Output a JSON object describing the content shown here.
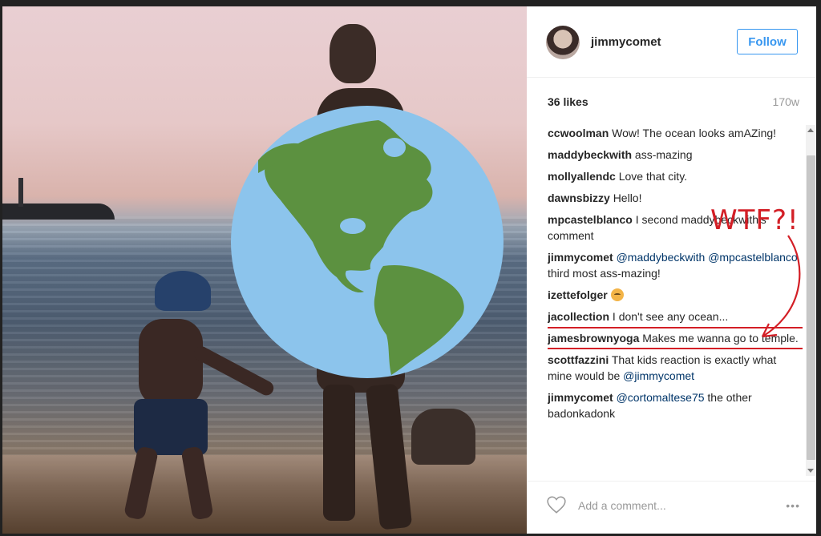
{
  "post": {
    "username": "jimmycomet",
    "follow_label": "Follow",
    "likes": "36 likes",
    "age": "170w",
    "comments": [
      {
        "user": "ccwoolman",
        "parts": [
          {
            "text": "Wow! The ocean looks amAZing!"
          }
        ]
      },
      {
        "user": "maddybeckwith",
        "parts": [
          {
            "text": "ass-mazing"
          }
        ]
      },
      {
        "user": "mollyallendc",
        "parts": [
          {
            "text": "Love that city."
          }
        ]
      },
      {
        "user": "dawnsbizzy",
        "parts": [
          {
            "text": "Hello!"
          }
        ]
      },
      {
        "user": "mpcastelblanco",
        "parts": [
          {
            "text": "I second maddybeckwith's comment"
          }
        ]
      },
      {
        "user": "jimmycomet",
        "parts": [
          {
            "mention": "@maddybeckwith"
          },
          {
            "text": " "
          },
          {
            "mention": "@mpcastelblanco"
          },
          {
            "text": " third most ass-mazing!"
          }
        ]
      },
      {
        "user": "izettefolger",
        "parts": [
          {
            "emoji": "flushed-face-emoji"
          }
        ]
      },
      {
        "user": "jacollection",
        "parts": [
          {
            "text": "I don't see any ocean..."
          }
        ]
      },
      {
        "user": "jamesbrownyoga",
        "parts": [
          {
            "text": "Makes me wanna go to temple."
          }
        ],
        "highlighted": true
      },
      {
        "user": "scottfazzini",
        "parts": [
          {
            "text": "That kids reaction is exactly what mine would be "
          },
          {
            "mention": "@jimmycomet"
          }
        ]
      },
      {
        "user": "jimmycomet",
        "parts": [
          {
            "mention": "@cortomaltese75"
          },
          {
            "text": " the other badonkadonk"
          }
        ]
      }
    ],
    "add_comment_placeholder": "Add a comment...",
    "more_label": "•••"
  },
  "annotation": {
    "text": "WTF?!",
    "color": "#d31f26"
  },
  "icons": {
    "globe": "globe-emoji-icon",
    "heart": "heart-outline-icon",
    "more": "more-options-icon"
  },
  "colors": {
    "follow_blue": "#3897f0",
    "mention_blue": "#003569",
    "annotation_red": "#d31f26"
  }
}
